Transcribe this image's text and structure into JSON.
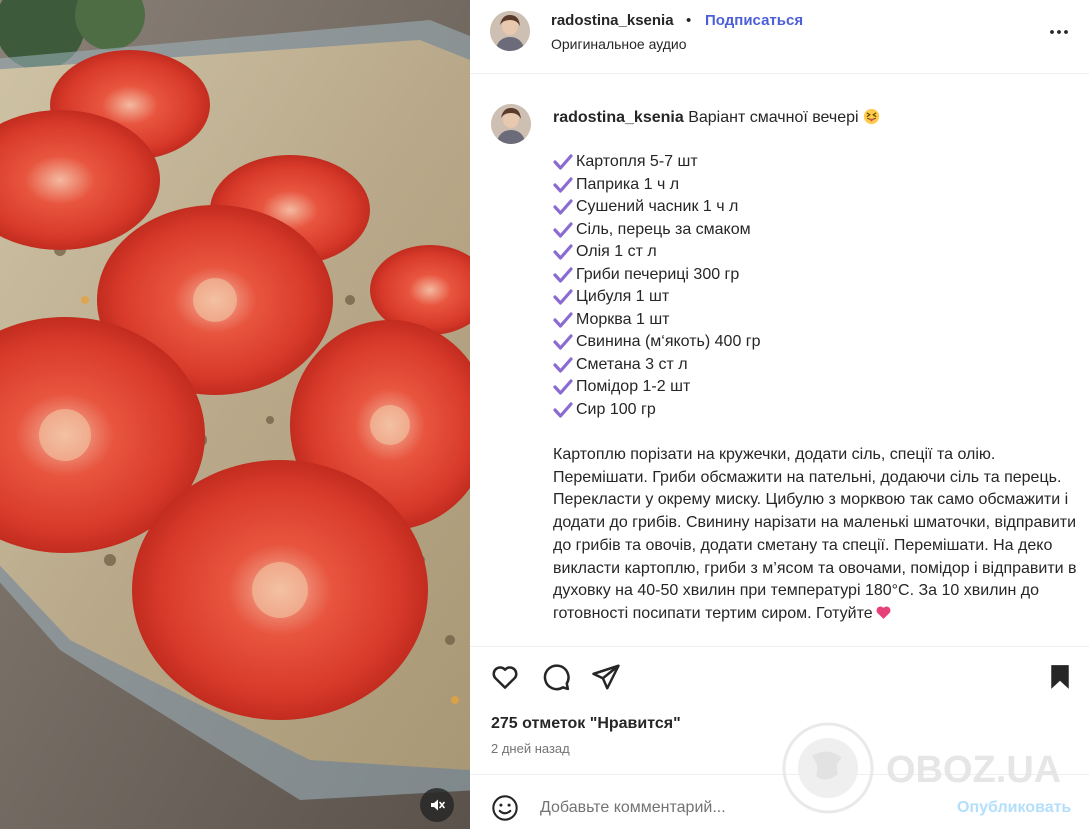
{
  "post": {
    "username": "radostina_ksenia",
    "follow_label": "Подписаться",
    "separator": "•",
    "audio": "Оригинальное аудио"
  },
  "caption": {
    "username": "radostina_ksenia",
    "text": "Варіант смачної вечері",
    "emoji": "squinting-face-tongue-emoji",
    "ingredients": [
      "Картопля 5-7 шт",
      "Паприка 1 ч л",
      "Сушений часник 1 ч л",
      "Сіль, перець за смаком",
      "Олія 1 ст л",
      "Гриби печериці 300 гр",
      "Цибуля 1 шт",
      "Морква 1 шт",
      "Свинина (м‘якоть) 400 гр",
      "Сметана 3 ст л",
      "Помідор 1-2 шт",
      "Сир 100 гр"
    ],
    "instructions": "Картоплю порізати на кружечки, додати сіль, спеції та олію. Перемішати. Гриби обсмажити на пательні, додаючи сіль та перець. Перекласти у окрему миску. Цибулю з морквою так само обсмажити і додати до грибів. Свинину нарізати на маленькі шматочки, відправити до грибів та овочів, додати сметану та спеції. Перемішати. На деко викласти картоплю, гриби з м’ясом та овочами, помідор і відправити в духовку на 40-50 хвилин при температурі 180°C. За 10 хвилин до готовності посипати тертим сиром. Готуйте",
    "heart_emoji": "pink-heart-emoji"
  },
  "actions": {
    "likes_text": "275 отметок \"Нравится\"",
    "date_text": "2 дней назад",
    "icons": [
      "heart-icon",
      "comment-icon",
      "share-icon",
      "bookmark-icon"
    ]
  },
  "comment": {
    "placeholder": "Добавьте комментарий...",
    "post_label": "Опубликовать"
  },
  "watermark": {
    "text": "OBOZ.UA"
  },
  "colors": {
    "accent": "#4c5fd7",
    "check": "#8a6bd1",
    "post_disabled": "#b2dffc",
    "secondary_text": "#737373",
    "heart": "#e8417a"
  }
}
